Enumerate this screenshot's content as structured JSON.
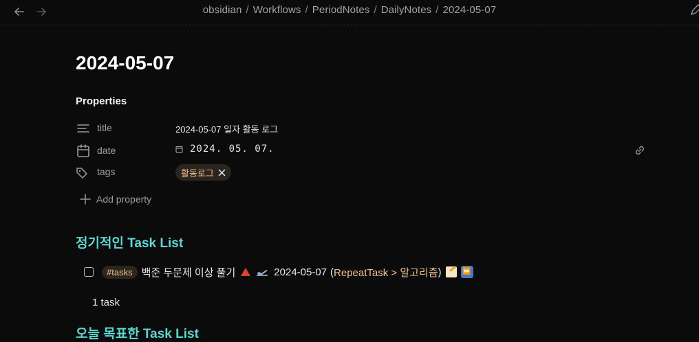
{
  "nav": {
    "back_icon": "arrow-left-icon",
    "forward_icon": "arrow-right-icon"
  },
  "breadcrumb": [
    "obsidian",
    "Workflows",
    "PeriodNotes",
    "DailyNotes",
    "2024-05-07"
  ],
  "note": {
    "title": "2024-05-07"
  },
  "properties": {
    "heading": "Properties",
    "title": {
      "key": "title",
      "value": "2024-05-07 일자 활동 로그"
    },
    "date": {
      "key": "date",
      "value": "2024. 05. 07."
    },
    "tags": {
      "key": "tags",
      "tag": "활동로그"
    },
    "add_label": "Add property"
  },
  "sections": {
    "recurring": "정기적인 Task List",
    "today": "오늘 목표한 Task List"
  },
  "task": {
    "tag": "#tasks",
    "text": "백준 두문제 이상 풀기",
    "date": "2024-05-07",
    "paren_open": "(",
    "link": "RepeatTask > 알고리즘",
    "paren_close": ")",
    "fast_label": "⏩"
  },
  "task_count": "1 task",
  "colors": {
    "accent": "#5fd6d0",
    "tag_text": "#f2c18d",
    "tag_bg": "#2b2520",
    "priority": "#e0412c"
  }
}
